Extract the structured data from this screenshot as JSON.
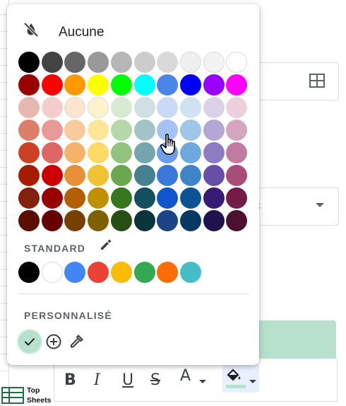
{
  "popup": {
    "none_label": "Aucune",
    "standard_label": "STANDARD",
    "custom_label": "PERSONNALISÉ",
    "palette_rows": [
      [
        "#000000",
        "#434343",
        "#666666",
        "#999999",
        "#b7b7b7",
        "#cccccc",
        "#d9d9d9",
        "#efefef",
        "#f3f3f3",
        "#ffffff"
      ],
      [
        "#980000",
        "#ff0000",
        "#ff9900",
        "#ffff00",
        "#00ff00",
        "#00ffff",
        "#4a86e8",
        "#0000ff",
        "#9900ff",
        "#ff00ff"
      ],
      [
        "#e6b8af",
        "#f4cccc",
        "#fce5cd",
        "#fff2cc",
        "#d9ead3",
        "#d0e0e3",
        "#c9daf8",
        "#cfe2f3",
        "#d9d2e9",
        "#ead1dc"
      ],
      [
        "#dd7e6b",
        "#ea9999",
        "#f9cb9c",
        "#ffe599",
        "#b6d7a8",
        "#a2c4c9",
        "#a4c2f4",
        "#9fc5e8",
        "#b4a7d6",
        "#d5a6bd"
      ],
      [
        "#cc4125",
        "#e06666",
        "#f6b26b",
        "#ffd966",
        "#93c47d",
        "#76a5af",
        "#6d9eeb",
        "#6fa8dc",
        "#8e7cc3",
        "#c27ba0"
      ],
      [
        "#a61c00",
        "#cc0000",
        "#e69138",
        "#f1c232",
        "#6aa84f",
        "#45818e",
        "#3c78d8",
        "#3d85c6",
        "#674ea7",
        "#a64d79"
      ],
      [
        "#85200c",
        "#990000",
        "#b45f06",
        "#bf9000",
        "#38761d",
        "#134f5c",
        "#1155cc",
        "#0b5394",
        "#351c75",
        "#741b47"
      ],
      [
        "#5b0f00",
        "#660000",
        "#783f04",
        "#7f6000",
        "#274e13",
        "#0c343d",
        "#1c4587",
        "#073763",
        "#20124d",
        "#4c1130"
      ]
    ],
    "standard_colors": [
      "#000000",
      "#ffffff",
      "#4285f4",
      "#ea4335",
      "#fbbc04",
      "#34a853",
      "#ff6d01",
      "#46bdc6"
    ],
    "custom_colors": [
      "#b7e1cd"
    ]
  },
  "background": {
    "band_color": "#b7e1cd",
    "toolbar": {
      "bold": "B",
      "italic": "I",
      "underline": "U",
      "strikethrough": "S",
      "text_color": "A"
    },
    "logo_line1": "Top",
    "logo_line2": "Sheets"
  },
  "icons": {
    "none": "format-color-reset-icon",
    "pencil": "pencil-icon",
    "add": "add-circle-icon",
    "eyedropper": "eyedropper-icon",
    "grid": "grid-icon",
    "fill": "fill-color-icon",
    "cursor": "hand-pointer-icon"
  }
}
